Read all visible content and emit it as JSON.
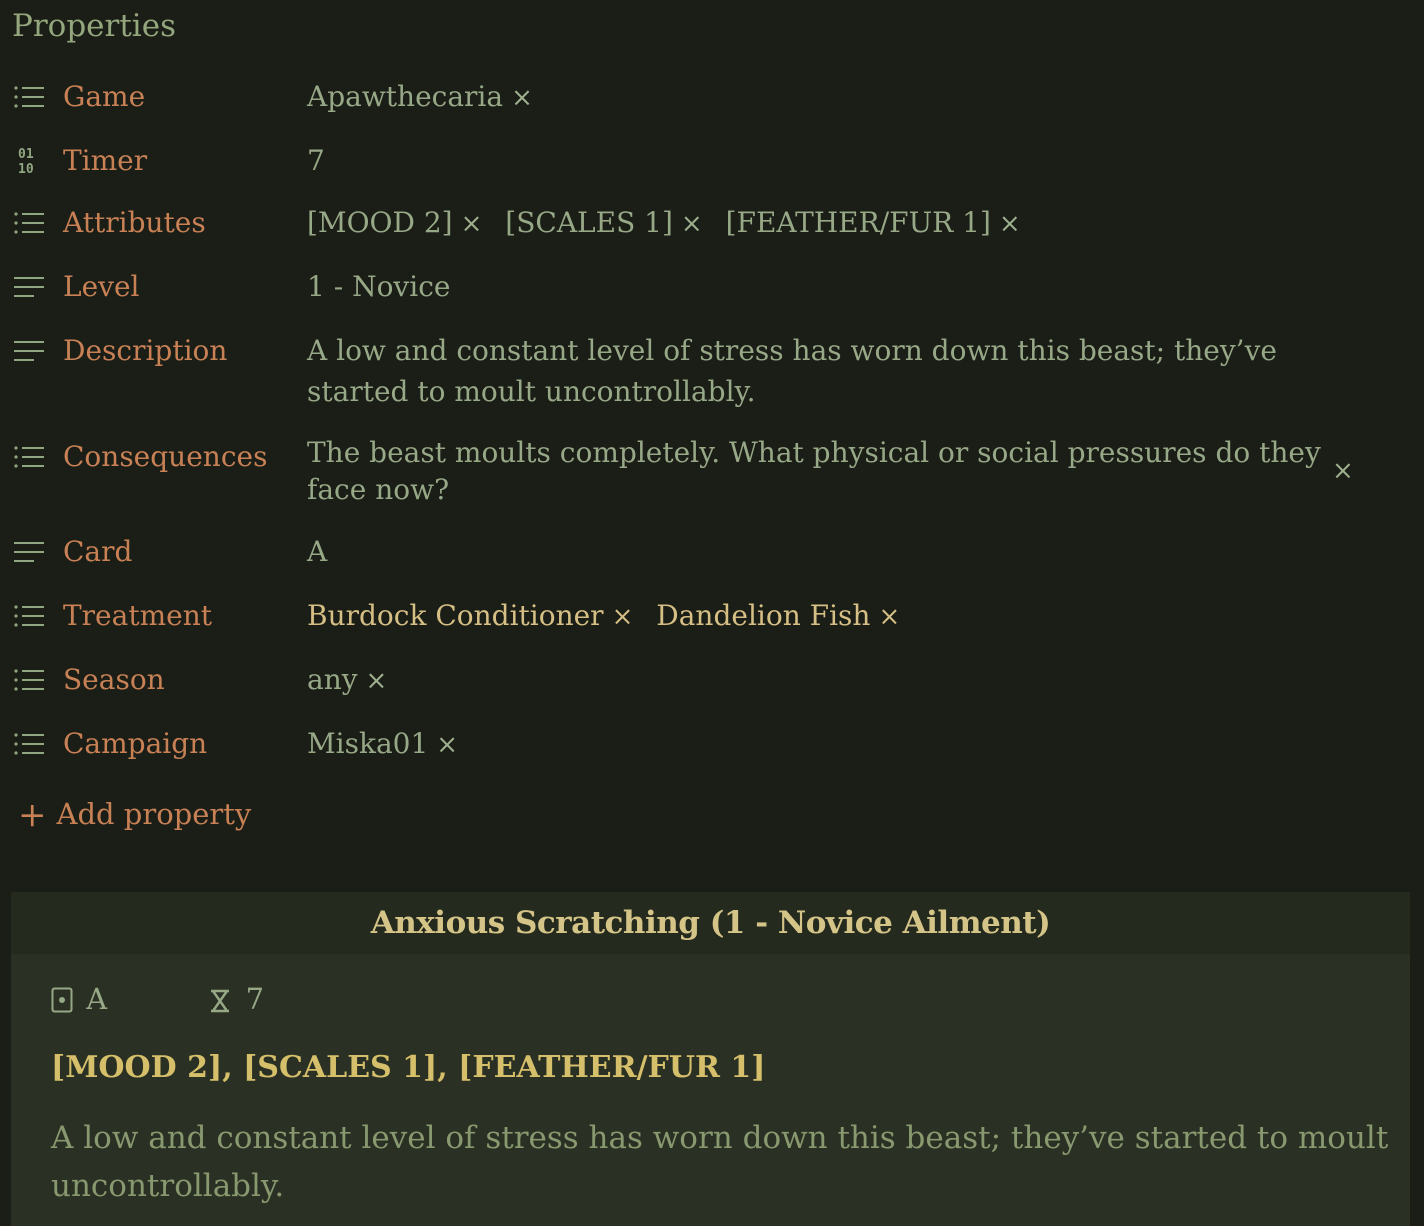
{
  "properties": {
    "header": "Properties",
    "game": {
      "label": "Game",
      "icon": "list-icon",
      "values": [
        "Apawthecaria"
      ]
    },
    "timer": {
      "label": "Timer",
      "icon": "number-icon",
      "value": "7"
    },
    "attributes": {
      "label": "Attributes",
      "icon": "list-icon",
      "values": [
        "[MOOD 2]",
        "[SCALES 1]",
        "[FEATHER/FUR 1]"
      ]
    },
    "level": {
      "label": "Level",
      "icon": "text-icon",
      "value": "1 - Novice"
    },
    "description": {
      "label": "Description",
      "icon": "text-icon",
      "value": "A low and constant level of stress has worn down this beast; they’ve started to moult uncontrollably."
    },
    "consequences": {
      "label": "Consequences",
      "icon": "list-icon",
      "value": "The beast moults completely. What physical or social pressures do they face now?"
    },
    "card": {
      "label": "Card",
      "icon": "text-icon",
      "value": "A"
    },
    "treatment": {
      "label": "Treatment",
      "icon": "list-icon",
      "values": [
        "Burdock Conditioner",
        "Dandelion Fish"
      ]
    },
    "season": {
      "label": "Season",
      "icon": "list-icon",
      "values": [
        "any"
      ]
    },
    "campaign": {
      "label": "Campaign",
      "icon": "list-icon",
      "values": [
        "Miska01"
      ]
    },
    "remove_glyph": "×",
    "add_property": {
      "plus": "+",
      "label": "Add property"
    }
  },
  "card_preview": {
    "title": "Anxious Scratching (1 - Novice Ailment)",
    "card_value": "A",
    "timer_value": "7",
    "attributes": "[MOOD 2], [SCALES 1], [FEATHER/FUR 1]",
    "description": "A low and constant level of stress has worn down this beast; they’ve started to moult uncontrollably."
  },
  "colors": {
    "background": "#1b1d17",
    "label": "#c78155",
    "value": "#97a887",
    "treatment": "#d6bf84",
    "card_background": "#2a3023",
    "card_title": "#d4c487",
    "card_attrs": "#d6bf6a"
  }
}
